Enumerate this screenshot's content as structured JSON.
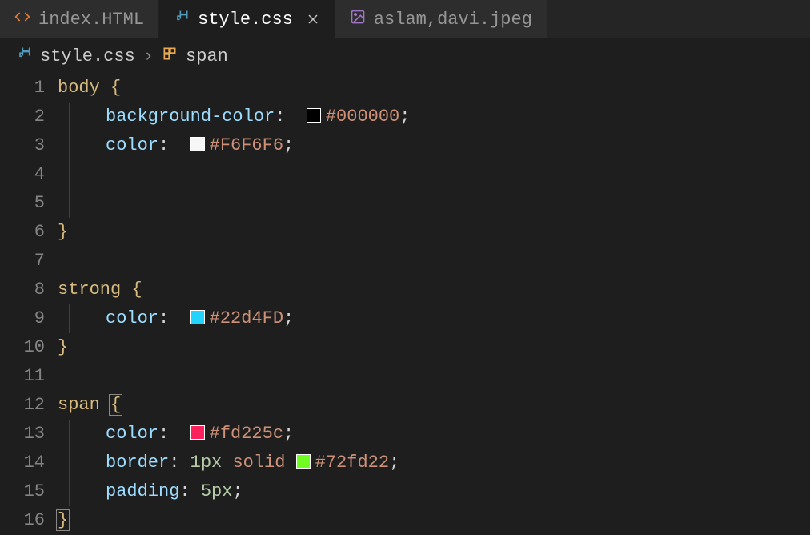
{
  "tabs": [
    {
      "label": "index.HTML",
      "icon": "html-icon"
    },
    {
      "label": "style.css",
      "icon": "css-icon",
      "active": true
    },
    {
      "label": "aslam,davi.jpeg",
      "icon": "image-icon"
    }
  ],
  "breadcrumb": {
    "file": "style.css",
    "symbol": "span",
    "sep": "›"
  },
  "gutter": [
    "1",
    "2",
    "3",
    "4",
    "5",
    "6",
    "7",
    "8",
    "9",
    "10",
    "11",
    "12",
    "13",
    "14",
    "15",
    "16"
  ],
  "code": {
    "l1": {
      "sel": "body",
      "brace": "{"
    },
    "l2": {
      "prop": "background-color",
      "colon": ":",
      "swatch": "#000000",
      "val": "#000000",
      "semi": ";"
    },
    "l3": {
      "prop": "color",
      "colon": ":",
      "swatch": "#F6F6F6",
      "val": "#F6F6F6",
      "semi": ";"
    },
    "l6": {
      "brace": "}"
    },
    "l8": {
      "sel": "strong",
      "brace": "{"
    },
    "l9": {
      "prop": "color",
      "colon": ":",
      "swatch": "#22d4FD",
      "val": "#22d4FD",
      "semi": ";"
    },
    "l10": {
      "brace": "}"
    },
    "l12": {
      "sel": "span",
      "brace": "{"
    },
    "l13": {
      "prop": "color",
      "colon": ":",
      "swatch": "#fd225c",
      "val": "#fd225c",
      "semi": ";"
    },
    "l14": {
      "prop": "border",
      "colon": ":",
      "num": "1px",
      "kw": "solid",
      "swatch": "#72fd22",
      "val": "#72fd22",
      "semi": ";"
    },
    "l15": {
      "prop": "padding",
      "colon": ":",
      "num": "5px",
      "semi": ";"
    },
    "l16": {
      "brace": "}"
    }
  }
}
